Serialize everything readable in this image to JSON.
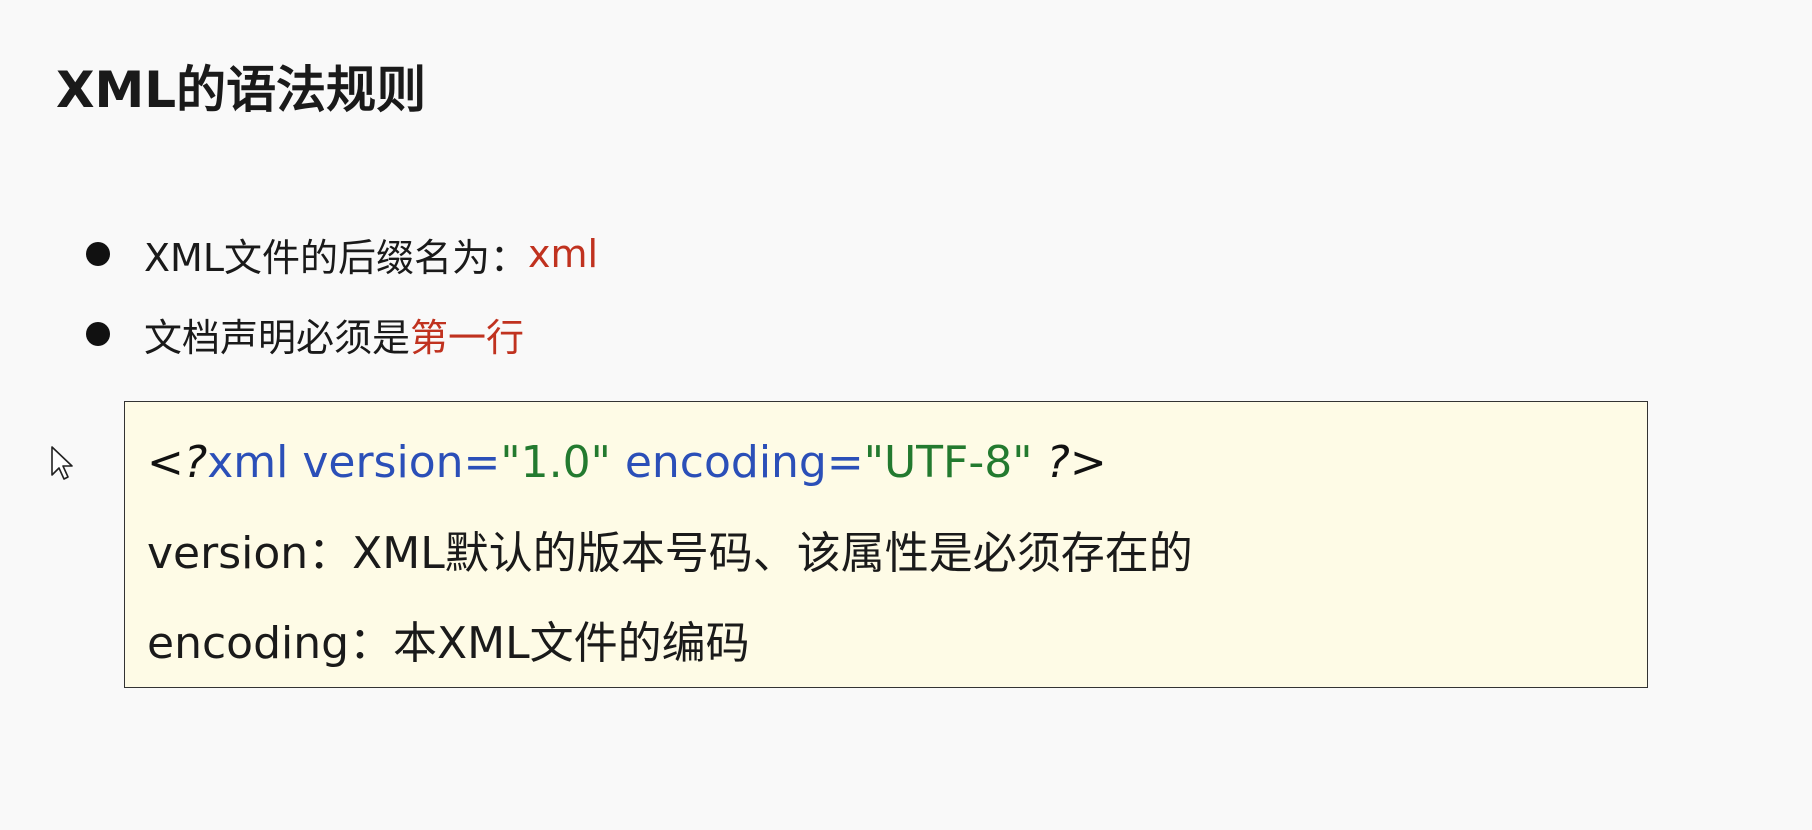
{
  "title": "XML的语法规则",
  "bullets": [
    {
      "text": "XML文件的后缀名为：",
      "highlight": "xml"
    },
    {
      "text": "文档声明必须是",
      "highlight": "第一行"
    }
  ],
  "code": {
    "decl_open": "<?",
    "decl_name": "xml",
    "attr1_name": " version=",
    "attr1_value": "\"1.0\"",
    "attr2_name": " encoding=",
    "attr2_value": "\"UTF-8\"",
    "decl_close": " ?>",
    "desc_version": "version：XML默认的版本号码、该属性是必须存在的",
    "desc_encoding": "encoding：本XML文件的编码"
  },
  "colors": {
    "highlight": "#c0321f",
    "keyword": "#2b4fb8",
    "string": "#237a2f",
    "box_bg": "#fefbe6"
  },
  "icons": [
    "pointer-cursor-icon"
  ]
}
